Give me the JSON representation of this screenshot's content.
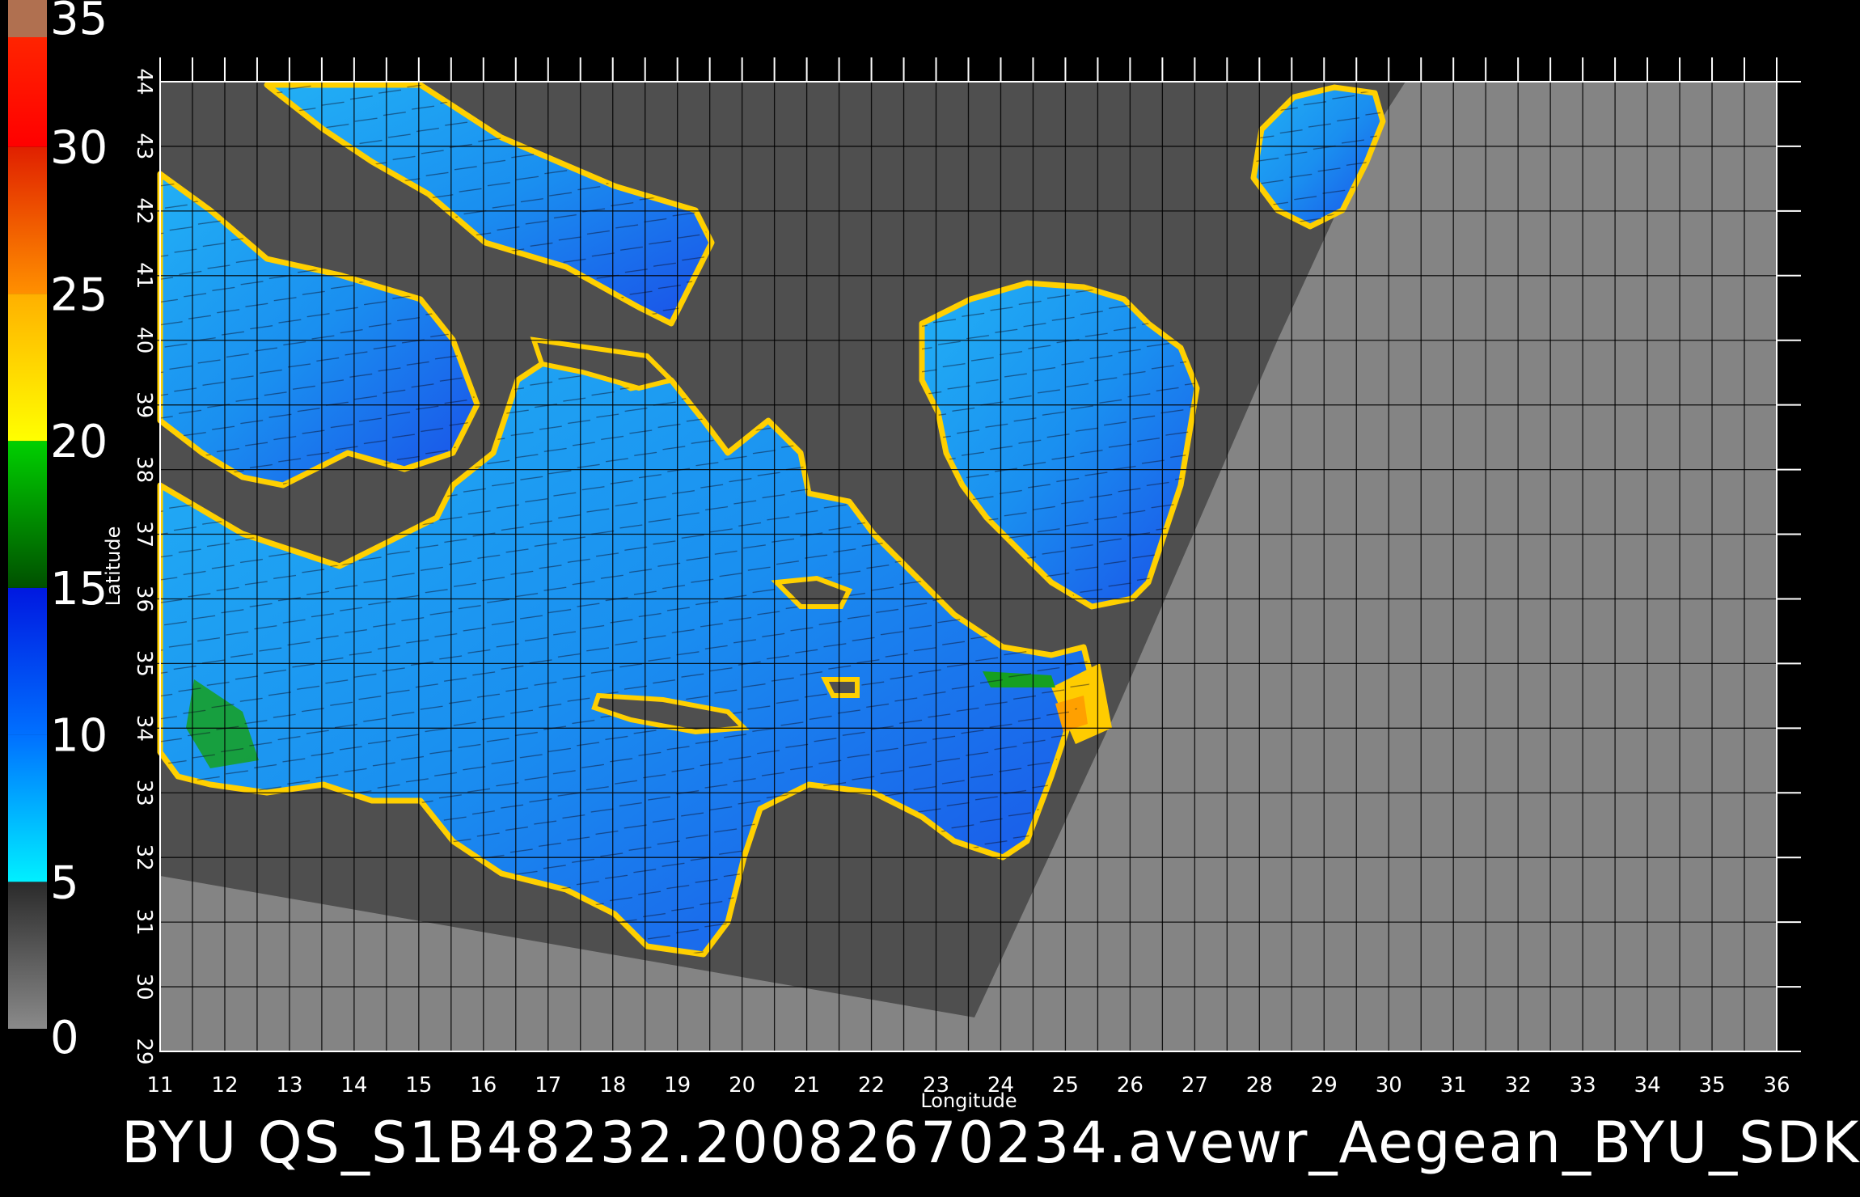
{
  "title": "BYU  QS_S1B48232.20082670234.avewr_Aegean_BYU_SDK",
  "map": {
    "xlabel": "Longitude",
    "ylabel": "Latitude",
    "lon_ticks": [
      "11",
      "12",
      "13",
      "14",
      "15",
      "16",
      "17",
      "18",
      "19",
      "20",
      "21",
      "22",
      "23",
      "24",
      "25",
      "26",
      "27",
      "28",
      "29",
      "30",
      "31",
      "32",
      "33",
      "34",
      "35",
      "36"
    ],
    "lat_ticks": [
      "29",
      "30",
      "31",
      "32",
      "33",
      "34",
      "35",
      "36",
      "37",
      "38",
      "39",
      "40",
      "41",
      "42",
      "43",
      "44"
    ],
    "lon_range": [
      11,
      36
    ],
    "lat_range": [
      29,
      44
    ],
    "grid": true
  },
  "colorbar": {
    "labels": [
      "0",
      "5",
      "10",
      "15",
      "20",
      "25",
      "30",
      "35"
    ],
    "segments": [
      {
        "from": 0,
        "to": 5,
        "color_low": "#8a8a8a",
        "color_high": "#2a2a2a"
      },
      {
        "from": 5,
        "to": 10,
        "color_low": "#00f0ff",
        "color_high": "#0070ff"
      },
      {
        "from": 10,
        "to": 15,
        "color_low": "#0070ff",
        "color_high": "#0018e0"
      },
      {
        "from": 15,
        "to": 20,
        "color_low": "#005000",
        "color_high": "#00d000"
      },
      {
        "from": 20,
        "to": 25,
        "color_low": "#ffff00",
        "color_high": "#ffb000"
      },
      {
        "from": 25,
        "to": 30,
        "color_low": "#ff9000",
        "color_high": "#e02000"
      },
      {
        "from": 30,
        "to": 35,
        "color_low": "#ff0000",
        "color_high": "#ff3000"
      }
    ],
    "top_color": "#b07050"
  },
  "colors": {
    "outside_swath": "#848484",
    "land": "#4f4f4f",
    "sea_primary": "#1aa0f0",
    "sea_deep": "#1040e0"
  }
}
